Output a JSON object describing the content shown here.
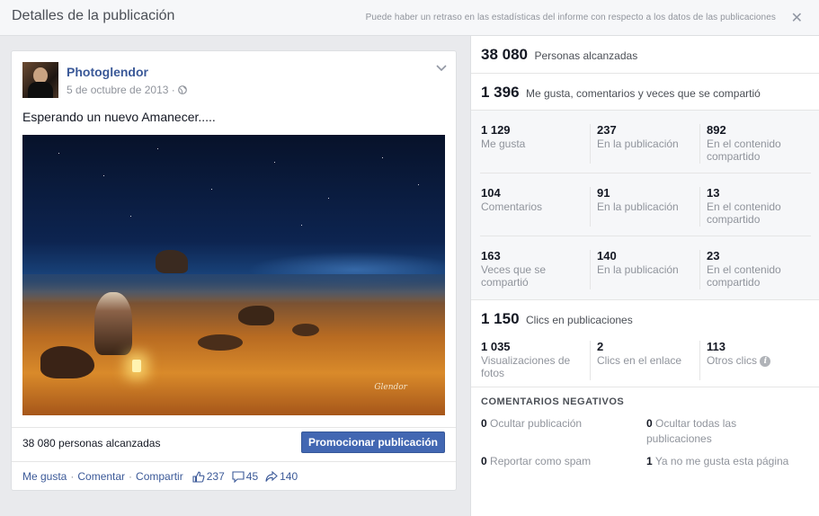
{
  "header": {
    "title": "Detalles de la publicación",
    "notice": "Puede haber un retraso en las estadísticas del informe con respecto a los datos de las publicaciones",
    "close_glyph": "✕"
  },
  "post": {
    "author": "Photoglendor",
    "date": "5 de octubre de 2013",
    "text": "Esperando un nuevo Amanecer.....",
    "photo_signature": "Glendor",
    "reach": "38 080 personas alcanzadas",
    "promote_label": "Promocionar publicación",
    "actions": {
      "like": "Me gusta",
      "comment": "Comentar",
      "share": "Compartir",
      "sep": "·",
      "likes_count": "237",
      "comments_count": "45",
      "shares_count": "140"
    }
  },
  "stats": {
    "reach": {
      "value": "38 080",
      "label": "Personas alcanzadas"
    },
    "engagement": {
      "value": "1 396",
      "label": "Me gusta, comentarios y veces que se compartió"
    },
    "likes": [
      {
        "value": "1 129",
        "label": "Me gusta"
      },
      {
        "value": "237",
        "label": "En la publicación"
      },
      {
        "value": "892",
        "label": "En el contenido compartido"
      }
    ],
    "comments": [
      {
        "value": "104",
        "label": "Comentarios"
      },
      {
        "value": "91",
        "label": "En la publicación"
      },
      {
        "value": "13",
        "label": "En el contenido compartido"
      }
    ],
    "shares": [
      {
        "value": "163",
        "label": "Veces que se compartió"
      },
      {
        "value": "140",
        "label": "En la publicación"
      },
      {
        "value": "23",
        "label": "En el contenido compartido"
      }
    ],
    "clicks": {
      "value": "1 150",
      "label": "Clics en publicaciones"
    },
    "click_breakdown": [
      {
        "value": "1 035",
        "label": "Visualizaciones de fotos"
      },
      {
        "value": "2",
        "label": "Clics en el enlace"
      },
      {
        "value": "113",
        "label": "Otros clics"
      }
    ],
    "negative": {
      "title": "COMENTARIOS NEGATIVOS",
      "items": [
        {
          "value": "0",
          "label": "Ocultar publicación"
        },
        {
          "value": "0",
          "label": "Ocultar todas las publicaciones"
        },
        {
          "value": "0",
          "label": "Reportar como spam"
        },
        {
          "value": "1",
          "label": "Ya no me gusta esta página"
        }
      ]
    }
  }
}
